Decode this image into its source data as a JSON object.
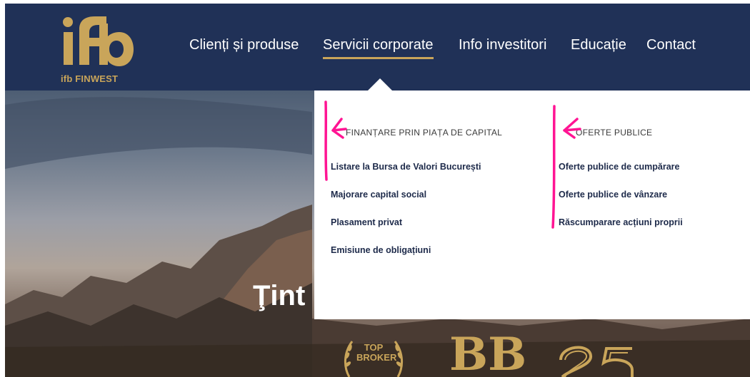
{
  "header": {
    "logo_text": "ifb FINWEST",
    "nav": [
      {
        "label": "Clienți și produse"
      },
      {
        "label": "Servicii corporate"
      },
      {
        "label": "Info investitori"
      },
      {
        "label": "Educație"
      },
      {
        "label": "Contact"
      }
    ]
  },
  "dropdown": {
    "columns": [
      {
        "heading": "FINANȚARE PRIN PIAȚA DE CAPITAL",
        "links": [
          "Listare la Bursa de Valori București",
          "Majorare capital social",
          "Plasament privat",
          "Emisiune de obligațiuni"
        ]
      },
      {
        "heading": "OFERTE PUBLICE",
        "links": [
          "Oferte publice de cumpărare",
          "Oferte publice de vânzare",
          "Răscumparare acțiuni proprii"
        ]
      }
    ]
  },
  "hero": {
    "title_partial": "Ţint",
    "badges": {
      "top_broker": "TOP BROKER",
      "bb": "BB",
      "anniversary": "25"
    }
  },
  "colors": {
    "header_bg": "#203157",
    "accent_gold": "#c9a55a",
    "annotation_pink": "#ff1493",
    "link_text": "#1d2a4a"
  }
}
